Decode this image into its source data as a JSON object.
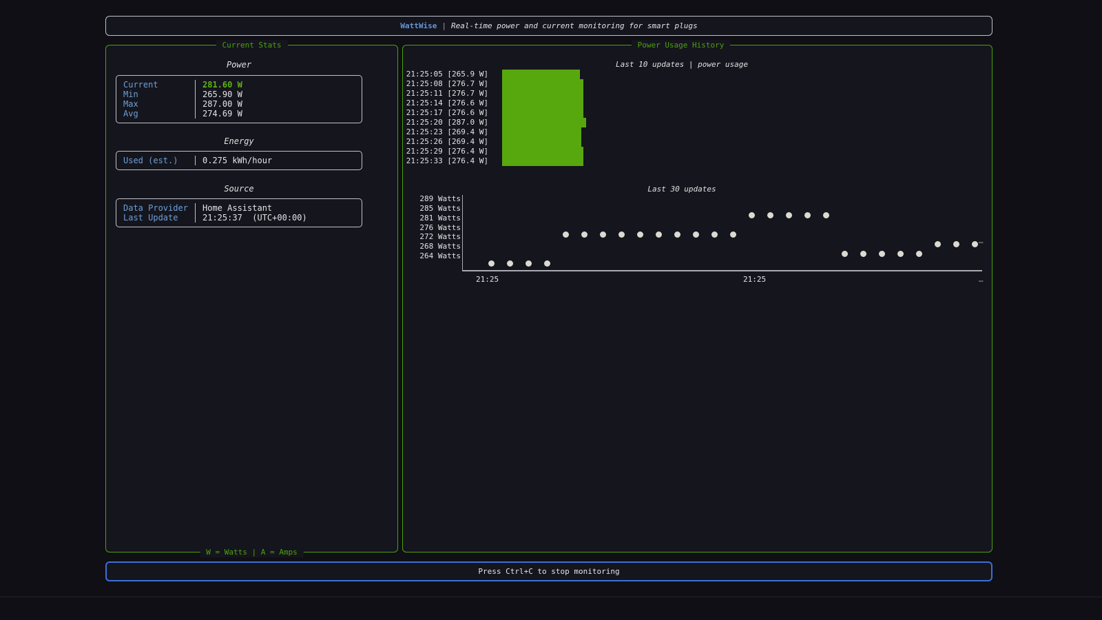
{
  "colors": {
    "background": "#0f0f15",
    "panel_background": "#15151d",
    "accent_green": "#4da20d",
    "bar_green": "#57a80e",
    "current_value_green": "#5db510",
    "label_blue": "#6ca0d8",
    "header_blue": "#6496d8",
    "footer_border_blue": "#3d6fd8",
    "axis_grey": "#aaaab0",
    "dot_color": "#dcd9d0"
  },
  "header": {
    "app_name": "WattWise",
    "separator": "|",
    "subtitle": "Real-time power and current monitoring for smart plugs"
  },
  "left_panel": {
    "title": "Current Stats",
    "footer_note": "W = Watts | A = Amps",
    "sections": {
      "power": {
        "title": "Power",
        "rows": [
          {
            "label": "Current",
            "value": "281.60 W"
          },
          {
            "label": "Min",
            "value": "265.90 W"
          },
          {
            "label": "Max",
            "value": "287.00 W"
          },
          {
            "label": "Avg",
            "value": "274.69 W"
          }
        ]
      },
      "energy": {
        "title": "Energy",
        "rows": [
          {
            "label": "Used (est.)",
            "value": "0.275 kWh/hour"
          }
        ]
      },
      "source": {
        "title": "Source",
        "rows": [
          {
            "label": "Data Provider",
            "value": "Home Assistant"
          },
          {
            "label": "Last Update",
            "value": "21:25:37  (UTC+00:00)"
          }
        ]
      }
    }
  },
  "right_panel": {
    "title": "Power Usage History"
  },
  "chart_data": [
    {
      "type": "bar",
      "orientation": "horizontal",
      "title": "Last 10 updates | power usage",
      "unit": "W",
      "categories": [
        "21:25:05",
        "21:25:08",
        "21:25:11",
        "21:25:14",
        "21:25:17",
        "21:25:20",
        "21:25:23",
        "21:25:26",
        "21:25:29",
        "21:25:33"
      ],
      "values": [
        265.9,
        276.7,
        276.7,
        276.6,
        276.6,
        287.0,
        269.4,
        269.4,
        276.4,
        276.4
      ],
      "xlim": [
        0,
        287
      ],
      "bar_color": "#57a80e",
      "legend": "none",
      "grid": false
    },
    {
      "type": "scatter",
      "title": "Last 30 updates",
      "ylabel": "",
      "xlabel": "",
      "y_tick_labels": [
        "289 Watts",
        "285 Watts",
        "281 Watts",
        "276 Watts",
        "272 Watts",
        "268 Watts",
        "264 Watts"
      ],
      "y_rows": [
        289,
        285,
        281,
        276,
        272,
        268,
        264
      ],
      "x_tick_labels": [
        "21:25",
        "21:25"
      ],
      "truncation_ellipsis": "…",
      "points": [
        264,
        264,
        264,
        264,
        276,
        276,
        276,
        276,
        276,
        276,
        276,
        276,
        276,
        276,
        285,
        285,
        285,
        285,
        285,
        268,
        268,
        268,
        268,
        268,
        272,
        272,
        272
      ],
      "dot_color": "#dcd9d0",
      "grid": false,
      "legend": "none"
    }
  ],
  "footer_bar": {
    "text": "Press Ctrl+C to stop monitoring"
  }
}
